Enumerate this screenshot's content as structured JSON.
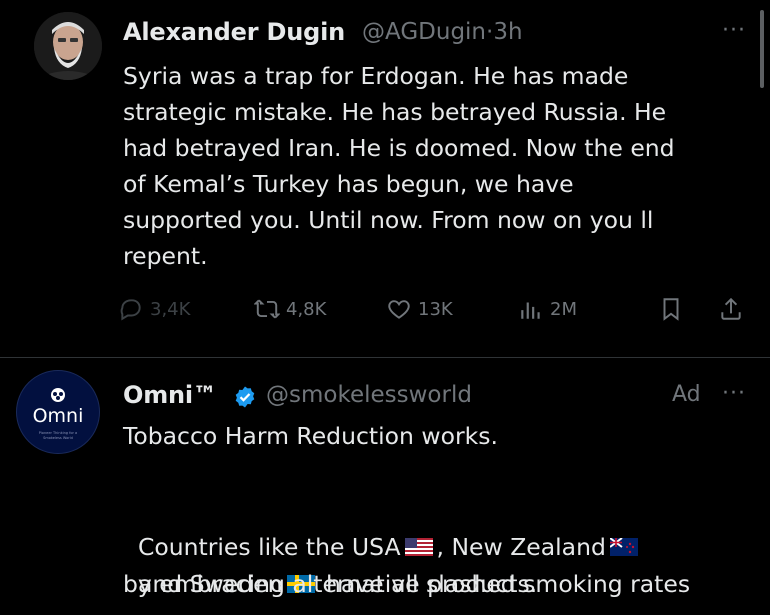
{
  "tweet1": {
    "name": "Alexander Dugin",
    "handle": "@AGDugin",
    "separator": "·",
    "time": "3h",
    "more": "···",
    "text": "Syria was a trap for Erdogan. He has made\nstrategic mistake. He has betrayed Russia. He\nhad betrayed Iran. He is doomed. Now the end\nof Kemal’s Turkey has begun, we have\nsupported you. Until now. From now on you ll\nrepent.",
    "replies": "3,4K",
    "reposts": "4,8K",
    "likes": "13K",
    "views": "2M"
  },
  "tweet2": {
    "name": "Omni™",
    "handle": "@smokelessworld",
    "ad_label": "Ad",
    "more": "···",
    "avatar_text": "Omni",
    "avatar_subtext": "Pioneer Thinking for a Smokeless World",
    "line1": "Tobacco Harm Reduction works.",
    "line2a": "Countries like the USA",
    "line2b": ", New Zealand",
    "line3a": "and Sweden",
    "line3b": " have all slashed smoking rates",
    "line4": "by embracing alternative products."
  },
  "colors": {
    "background": "#000000",
    "text": "#e7e9ea",
    "secondary": "#71767b",
    "verified": "#1d9bf0",
    "divider": "#2f3336"
  },
  "icons": [
    "reply-icon",
    "repost-icon",
    "like-icon",
    "views-icon",
    "bookmark-icon",
    "share-icon",
    "verified-icon",
    "more-icon",
    "flag-usa-icon",
    "flag-nz-icon",
    "flag-sweden-icon"
  ]
}
